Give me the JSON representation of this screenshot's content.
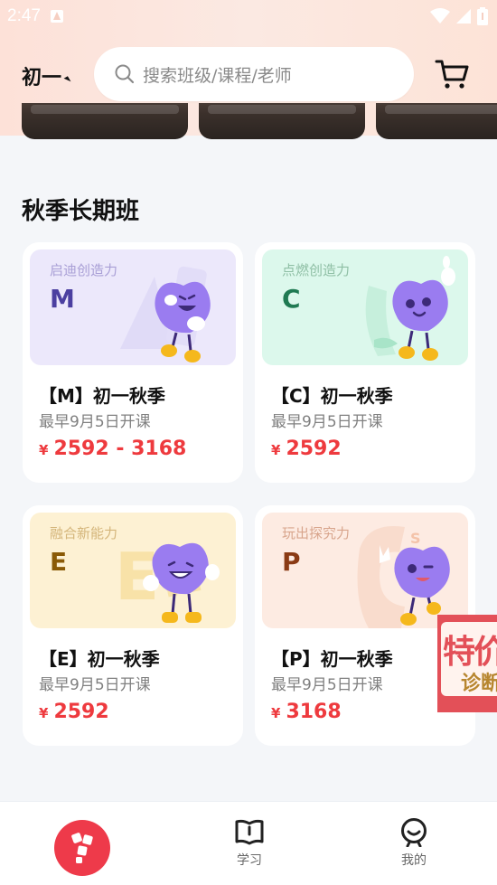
{
  "status_bar": {
    "time": "2:47"
  },
  "header": {
    "grade": "初一",
    "search_placeholder": "搜索班级/课程/老师"
  },
  "section": {
    "title": "秋季长期班"
  },
  "courses": [
    {
      "tagline": "启迪创造力",
      "letter": "M",
      "title": "【M】初一秋季",
      "start": "最早9月5日开课",
      "currency": "¥",
      "price": "2592 - 3168",
      "theme_bg": "#ece8fb",
      "tagline_color": "#a99fd6",
      "letter_color": "#4b3fa0"
    },
    {
      "tagline": "点燃创造力",
      "letter": "C",
      "title": "【C】初一秋季",
      "start": "最早9月5日开课",
      "currency": "¥",
      "price": "2592",
      "theme_bg": "#dcf8ec",
      "tagline_color": "#8fbfa5",
      "letter_color": "#1f7a52"
    },
    {
      "tagline": "融合新能力",
      "letter": "E",
      "title": "【E】初一秋季",
      "start": "最早9月5日开课",
      "currency": "¥",
      "price": "2592",
      "theme_bg": "#fdf1d3",
      "tagline_color": "#d4b57a",
      "letter_color": "#8a5a06"
    },
    {
      "tagline": "玩出探究力",
      "letter": "P",
      "title": "【P】初一秋季",
      "start": "最早9月5日开课",
      "currency": "¥",
      "price": "3168",
      "theme_bg": "#fdebe2",
      "tagline_color": "#d8a58c",
      "letter_color": "#8a3a14"
    }
  ],
  "promo": {
    "big": "特价",
    "small": "诊断"
  },
  "bottom_nav": {
    "study_label": "学习",
    "mine_label": "我的"
  },
  "colors": {
    "accent_red": "#ee3a3e",
    "mascot_purple": "#9a7cf0"
  }
}
